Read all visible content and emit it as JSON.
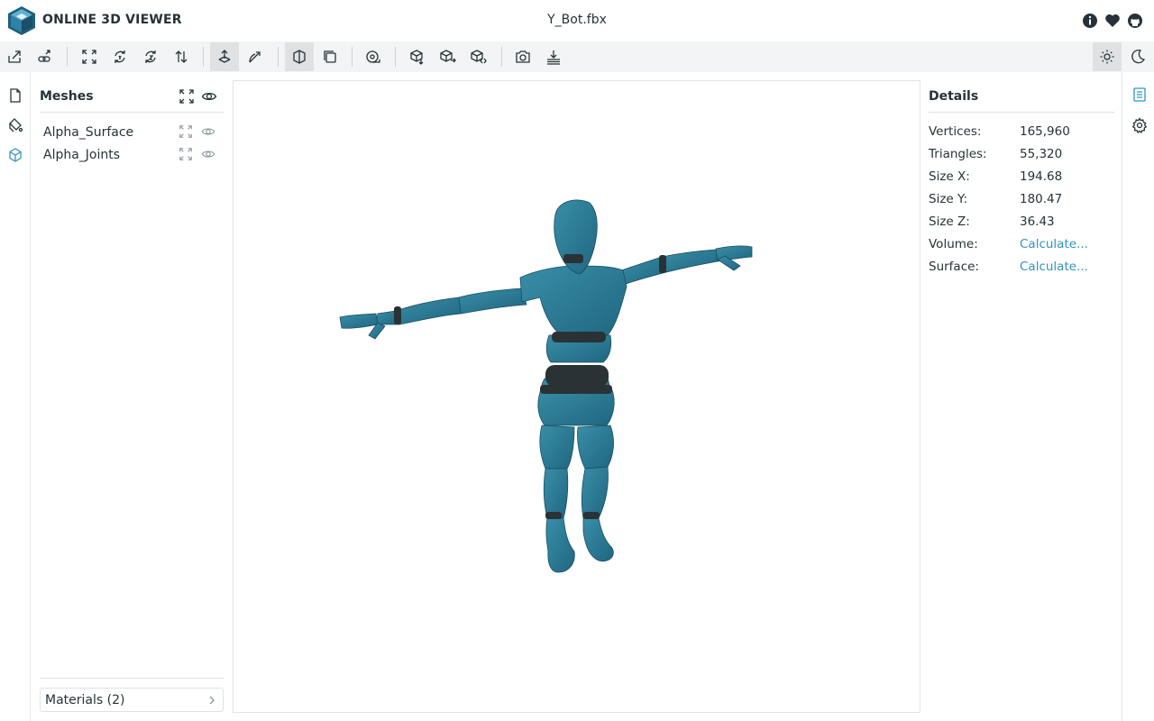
{
  "header": {
    "app_title": "ONLINE 3D VIEWER",
    "file_title": "Y_Bot.fbx",
    "icons": [
      "info-icon",
      "heart-icon",
      "github-icon"
    ]
  },
  "toolbar": {
    "buttons": [
      {
        "name": "open-file-icon"
      },
      {
        "name": "open-url-icon"
      },
      {
        "name": "fit-to-window-icon"
      },
      {
        "name": "set-up-y-icon"
      },
      {
        "name": "set-up-z-icon"
      },
      {
        "name": "flip-up-icon"
      },
      {
        "name": "fixed-up-vector-icon",
        "selected": true
      },
      {
        "name": "free-orbit-icon"
      },
      {
        "name": "perspective-camera-icon",
        "selected": true
      },
      {
        "name": "orthographic-camera-icon"
      },
      {
        "name": "measure-icon"
      },
      {
        "name": "export-icon"
      },
      {
        "name": "share-icon"
      },
      {
        "name": "embed-icon"
      },
      {
        "name": "snapshot-icon"
      },
      {
        "name": "snapshot-save-icon"
      }
    ],
    "theme_buttons": [
      {
        "name": "light-mode-icon",
        "selected": true
      },
      {
        "name": "dark-mode-icon"
      }
    ]
  },
  "left_nav": [
    "files-icon",
    "materials-icon",
    "meshes-icon"
  ],
  "meshes": {
    "title": "Meshes",
    "items": [
      {
        "label": "Alpha_Surface"
      },
      {
        "label": "Alpha_Joints"
      }
    ],
    "materials_label": "Materials (2)"
  },
  "viewer": {
    "model_color": "#2b7a93",
    "joint_color": "#2a3236"
  },
  "details": {
    "title": "Details",
    "rows": [
      {
        "label": "Vertices:",
        "value": "165,960"
      },
      {
        "label": "Triangles:",
        "value": "55,320"
      },
      {
        "label": "Size X:",
        "value": "194.68"
      },
      {
        "label": "Size Y:",
        "value": "180.47"
      },
      {
        "label": "Size Z:",
        "value": "36.43"
      },
      {
        "label": "Volume:",
        "value": "Calculate...",
        "link": true
      },
      {
        "label": "Surface:",
        "value": "Calculate...",
        "link": true
      }
    ]
  },
  "right_nav": [
    "details-icon",
    "settings-icon"
  ],
  "colors": {
    "accent": "#3393bd",
    "toolbar_bg": "#f3f4f5",
    "text": "#263238"
  }
}
